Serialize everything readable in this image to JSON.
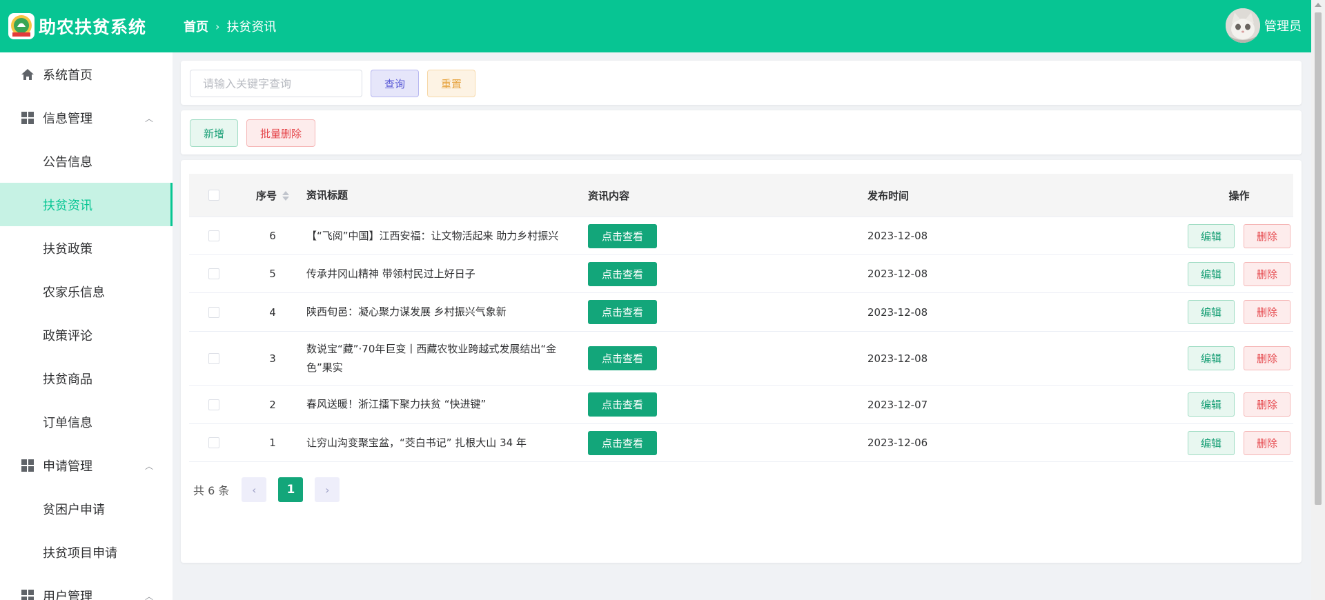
{
  "header": {
    "app_title": "助农扶贫系统",
    "logo_icon": "app-logo",
    "breadcrumb": [
      "首页",
      "扶贫资讯"
    ],
    "breadcrumb_separator": "›",
    "user_name": "管理员",
    "avatar_icon": "cat-avatar"
  },
  "sidebar": {
    "items": [
      {
        "label": "系统首页",
        "icon": "home-icon",
        "type": "item"
      },
      {
        "label": "信息管理",
        "icon": "grid-icon",
        "type": "group",
        "expanded": true
      },
      {
        "label": "公告信息",
        "type": "sub"
      },
      {
        "label": "扶贫资讯",
        "type": "sub",
        "active": true
      },
      {
        "label": "扶贫政策",
        "type": "sub"
      },
      {
        "label": "农家乐信息",
        "type": "sub"
      },
      {
        "label": "政策评论",
        "type": "sub"
      },
      {
        "label": "扶贫商品",
        "type": "sub"
      },
      {
        "label": "订单信息",
        "type": "sub"
      },
      {
        "label": "申请管理",
        "icon": "grid-icon",
        "type": "group",
        "expanded": true
      },
      {
        "label": "贫困户申请",
        "type": "sub"
      },
      {
        "label": "扶贫项目申请",
        "type": "sub"
      },
      {
        "label": "用户管理",
        "icon": "grid-icon",
        "type": "group",
        "expanded": true
      }
    ]
  },
  "search": {
    "placeholder": "请输入关键字查询",
    "value": "",
    "query_label": "查询",
    "reset_label": "重置"
  },
  "actions": {
    "add_label": "新增",
    "batch_delete_label": "批量删除"
  },
  "table": {
    "headers": {
      "index": "序号",
      "title": "资讯标题",
      "content": "资讯内容",
      "time": "发布时间",
      "ops": "操作"
    },
    "view_label": "点击查看",
    "edit_label": "编辑",
    "delete_label": "删除",
    "rows": [
      {
        "index": "6",
        "title": "【“飞阅”中国】江西安福：让文物活起来 助力乡村振兴",
        "time": "2023-12-08"
      },
      {
        "index": "5",
        "title": "传承井冈山精神 带领村民过上好日子",
        "time": "2023-12-08"
      },
      {
        "index": "4",
        "title": "陕西旬邑：凝心聚力谋发展 乡村振兴气象新",
        "time": "2023-12-08"
      },
      {
        "index": "3",
        "title": "数说宝“藏”·70年巨变丨西藏农牧业跨越式发展结出“金色”果实",
        "time": "2023-12-08"
      },
      {
        "index": "2",
        "title": "春风送暖！浙江擂下聚力扶贫 “快进键”",
        "time": "2023-12-07"
      },
      {
        "index": "1",
        "title": "让穷山沟变聚宝盆，“茭白书记” 扎根大山 34 年",
        "time": "2023-12-06"
      }
    ]
  },
  "pagination": {
    "total_text": "共 6 条",
    "current_page": "1",
    "prev_icon": "chevron-left-icon",
    "next_icon": "chevron-right-icon"
  },
  "colors": {
    "brand": "#07c593",
    "primary_button": "#13a67a",
    "active_menu_bg": "#c6f2e4"
  }
}
